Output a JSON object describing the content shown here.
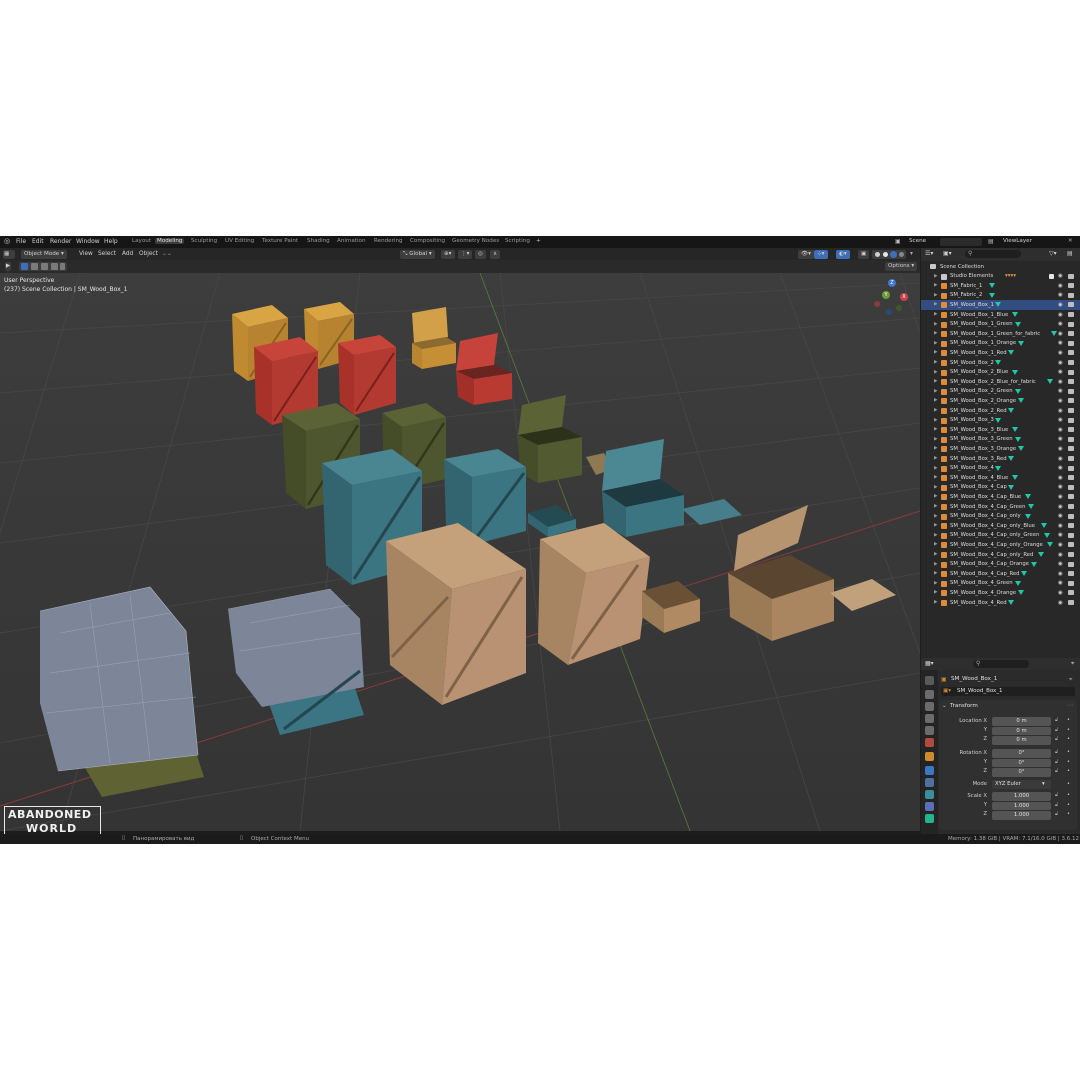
{
  "menu": {
    "items": [
      "File",
      "Edit",
      "Render",
      "Window",
      "Help"
    ]
  },
  "workspaces": {
    "tabs": [
      "Layout",
      "Modeling",
      "Sculpting",
      "UV Editing",
      "Texture Paint",
      "Shading",
      "Animation",
      "Rendering",
      "Compositing",
      "Geometry Nodes",
      "Scripting"
    ],
    "active": "Modeling",
    "add": "+"
  },
  "scene": {
    "label": "Scene",
    "view_layer": "ViewLayer"
  },
  "viewport_header": {
    "mode": "Object Mode",
    "menus": [
      "View",
      "Select",
      "Add",
      "Object"
    ],
    "transform_orientation": "Global",
    "options": "Options"
  },
  "viewport": {
    "perspective": "User Perspective",
    "collection_info": "(237) Scene Collection | SM_Wood_Box_1"
  },
  "gizmo": {
    "x": "X",
    "y": "Y",
    "z": "Z"
  },
  "outliner": {
    "root": "Scene Collection",
    "items": [
      {
        "name": "Studio Elements",
        "type": "collection"
      },
      {
        "name": "SM_Fabric_1",
        "type": "mesh"
      },
      {
        "name": "SM_Fabric_2",
        "type": "mesh"
      },
      {
        "name": "SM_Wood_Box_1",
        "type": "mesh",
        "selected": true
      },
      {
        "name": "SM_Wood_Box_1_Blue",
        "type": "mesh"
      },
      {
        "name": "SM_Wood_Box_1_Green",
        "type": "mesh"
      },
      {
        "name": "SM_Wood_Box_1_Green_for_fabric",
        "type": "mesh"
      },
      {
        "name": "SM_Wood_Box_1_Orange",
        "type": "mesh"
      },
      {
        "name": "SM_Wood_Box_1_Red",
        "type": "mesh"
      },
      {
        "name": "SM_Wood_Box_2",
        "type": "mesh"
      },
      {
        "name": "SM_Wood_Box_2_Blue",
        "type": "mesh"
      },
      {
        "name": "SM_Wood_Box_2_Blue_for_fabric",
        "type": "mesh"
      },
      {
        "name": "SM_Wood_Box_2_Green",
        "type": "mesh"
      },
      {
        "name": "SM_Wood_Box_2_Orange",
        "type": "mesh"
      },
      {
        "name": "SM_Wood_Box_2_Red",
        "type": "mesh"
      },
      {
        "name": "SM_Wood_Box_3",
        "type": "mesh"
      },
      {
        "name": "SM_Wood_Box_3_Blue",
        "type": "mesh"
      },
      {
        "name": "SM_Wood_Box_3_Green",
        "type": "mesh"
      },
      {
        "name": "SM_Wood_Box_3_Orange",
        "type": "mesh"
      },
      {
        "name": "SM_Wood_Box_3_Red",
        "type": "mesh"
      },
      {
        "name": "SM_Wood_Box_4",
        "type": "mesh"
      },
      {
        "name": "SM_Wood_Box_4_Blue",
        "type": "mesh"
      },
      {
        "name": "SM_Wood_Box_4_Cap",
        "type": "mesh"
      },
      {
        "name": "SM_Wood_Box_4_Cap_Blue",
        "type": "mesh"
      },
      {
        "name": "SM_Wood_Box_4_Cap_Green",
        "type": "mesh"
      },
      {
        "name": "SM_Wood_Box_4_Cap_only",
        "type": "mesh"
      },
      {
        "name": "SM_Wood_Box_4_Cap_only_Blue",
        "type": "mesh"
      },
      {
        "name": "SM_Wood_Box_4_Cap_only_Green",
        "type": "mesh"
      },
      {
        "name": "SM_Wood_Box_4_Cap_only_Orange",
        "type": "mesh"
      },
      {
        "name": "SM_Wood_Box_4_Cap_only_Red",
        "type": "mesh"
      },
      {
        "name": "SM_Wood_Box_4_Cap_Orange",
        "type": "mesh"
      },
      {
        "name": "SM_Wood_Box_4_Cap_Red",
        "type": "mesh"
      },
      {
        "name": "SM_Wood_Box_4_Green",
        "type": "mesh"
      },
      {
        "name": "SM_Wood_Box_4_Orange",
        "type": "mesh"
      },
      {
        "name": "SM_Wood_Box_4_Red",
        "type": "mesh"
      }
    ]
  },
  "properties": {
    "object_name": "SM_Wood_Box_1",
    "object_field": "SM_Wood_Box_1",
    "panel": "Transform",
    "location": {
      "label": "Location X",
      "y": "Y",
      "z": "Z",
      "values": [
        "0 m",
        "0 m",
        "0 m"
      ]
    },
    "rotation": {
      "label": "Rotation X",
      "y": "Y",
      "z": "Z",
      "values": [
        "0°",
        "0°",
        "0°"
      ]
    },
    "mode": {
      "label": "Mode",
      "value": "XYZ Euler"
    },
    "scale": {
      "label": "Scale X",
      "y": "Y",
      "z": "Z",
      "values": [
        "1.000",
        "1.000",
        "1.000"
      ]
    }
  },
  "status": {
    "pan": "Панорамировать вид",
    "context": "Object Context Menu",
    "memory": "Memory: 1.38 GiB | VRAM: 7.1/16.0 GiB | 3.6.12"
  },
  "logo": {
    "line1": "ABANDONED",
    "line2": "WORLD"
  },
  "colors": {
    "accent": "#3d6fb8",
    "mesh_vertex": "#21c7a8",
    "orange_box": "#c9922d",
    "red_box": "#b6372e",
    "green_box": "#4d5530",
    "blue_box": "#3a7480",
    "natural_box": "#b08a63"
  }
}
